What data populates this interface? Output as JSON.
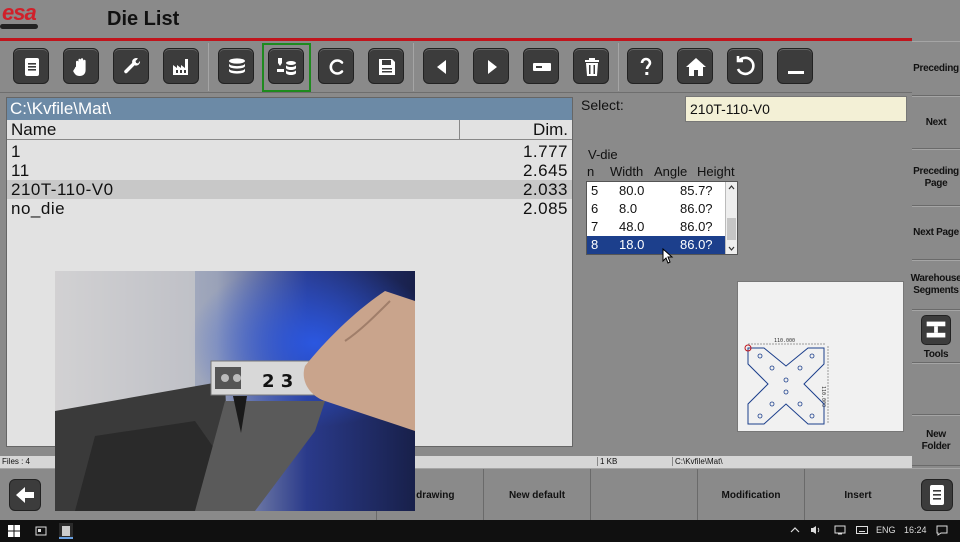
{
  "header": {
    "logo": "esa",
    "title": "Die List"
  },
  "toolbar": {
    "buttons": [
      "document-icon",
      "hand-icon",
      "wrench-icon",
      "factory-icon",
      "database-stack-icon",
      "die-database-icon",
      "c-icon",
      "save-icon",
      "arrow-left-icon",
      "arrow-right-icon",
      "minus-box-icon",
      "trash-icon",
      "help-icon",
      "home-icon",
      "undo-icon",
      "minimize-icon"
    ]
  },
  "sidebar": {
    "items": [
      "Preceding",
      "Next",
      "Preceding Page",
      "Next Page",
      "Warehouse Segments",
      "Tools",
      "",
      "New Folder"
    ]
  },
  "filepanel": {
    "path": "C:\\Kvfile\\Mat\\",
    "columns": {
      "name": "Name",
      "dim": "Dim."
    },
    "rows": [
      {
        "name": "1",
        "dim": "1.777"
      },
      {
        "name": "11",
        "dim": "2.645"
      },
      {
        "name": "210T-110-V0",
        "dim": "2.033"
      },
      {
        "name": "no_die",
        "dim": "2.085"
      }
    ]
  },
  "select": {
    "label": "Select:",
    "value": "210T-110-V0"
  },
  "vdie": {
    "title": "V-die",
    "columns": {
      "n": "n",
      "width": "Width",
      "angle": "Angle",
      "height": "Height"
    },
    "rows": [
      {
        "n": "5",
        "width": "80.0",
        "angle": "85.7?"
      },
      {
        "n": "6",
        "width": "8.0",
        "angle": "86.0?"
      },
      {
        "n": "7",
        "width": "48.0",
        "angle": "86.0?"
      },
      {
        "n": "8",
        "width": "18.0",
        "angle": "86.0?"
      }
    ]
  },
  "preview": {
    "dim_top": "110.000",
    "dim_right": "110.000"
  },
  "video": {
    "tape_numbers": "2 3"
  },
  "statusbar": {
    "files": "Files : 4",
    "size": "1 KB",
    "path": "C:\\Kvfile\\Mat\\"
  },
  "bottombar": {
    "items": [
      "w drawing",
      "New default",
      "Modification",
      "Insert"
    ]
  },
  "taskbar": {
    "lang": "ENG",
    "time": "16:24"
  },
  "colors": {
    "accent_red": "#c0141c",
    "path_blue": "#6c8aa6",
    "selection_blue": "#1c3f8c",
    "active_green": "#1e8a1e"
  }
}
